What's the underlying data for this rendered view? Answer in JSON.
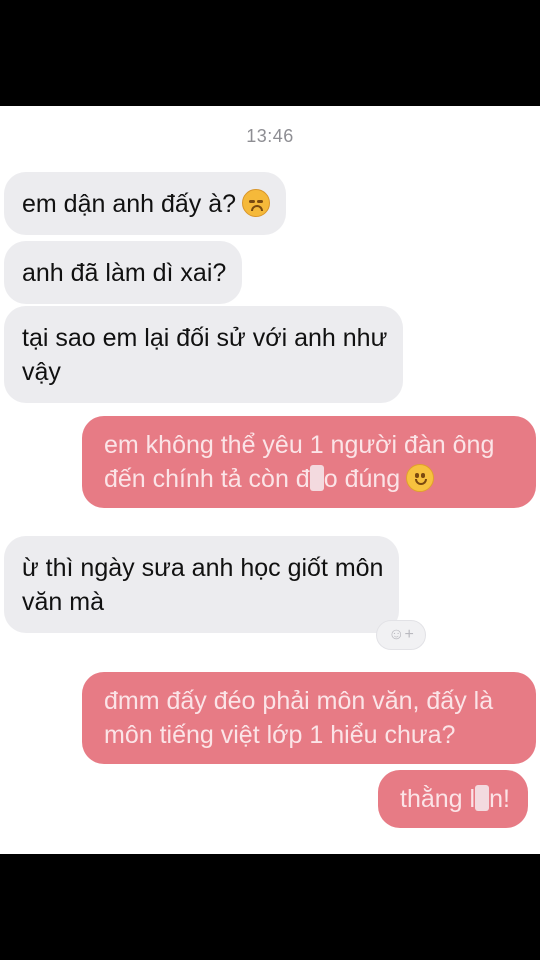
{
  "header": {
    "timestamp": "13:46"
  },
  "messages": [
    {
      "from": "them",
      "text": "em dận anh đấy à?",
      "emoji": "disappointed-face"
    },
    {
      "from": "them",
      "text": "anh đã làm dì xai?"
    },
    {
      "from": "them",
      "line1": "tại sao em lại đối sử với anh như",
      "line2": "vậy"
    },
    {
      "from": "me",
      "line1": "em không thể yêu 1 người đàn ông",
      "line2a": "đến chính tả còn đ",
      "line2b": "o đúng",
      "emoji": "slightly-smiling-face"
    },
    {
      "from": "them",
      "line1": "ừ thì ngày sưa anh học giốt môn",
      "line2": "văn mà"
    },
    {
      "from": "me",
      "line1": "đmm đấy đéo phải môn văn, đấy là",
      "line2": "môn tiếng việt lớp 1 hiểu chưa?"
    },
    {
      "from": "me",
      "text_a": "thằng l",
      "text_b": "n!"
    }
  ],
  "reaction_button": {
    "label": "☺+",
    "icon": "add-reaction-icon"
  },
  "colors": {
    "outgoing_bubble": "#e77b85",
    "incoming_bubble": "#ececef",
    "frame": "#000000"
  }
}
